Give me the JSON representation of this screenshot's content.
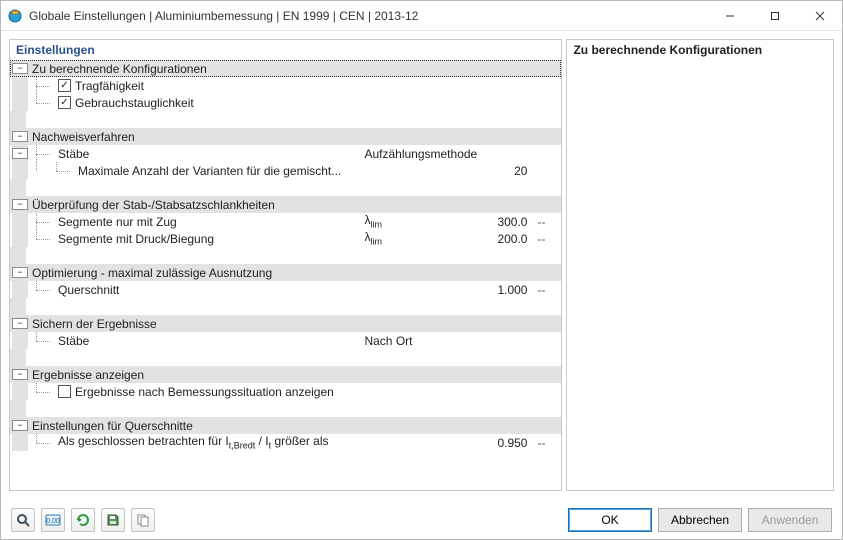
{
  "window": {
    "title": "Globale Einstellungen | Aluminiumbemessung | EN 1999 | CEN | 2013-12"
  },
  "left_panel_header": "Einstellungen",
  "right_panel_header": "Zu berechnende Konfigurationen",
  "sections": {
    "configs": {
      "title": "Zu berechnende Konfigurationen",
      "items": {
        "tragf": "Tragfähigkeit",
        "gebr": "Gebrauchstauglichkeit"
      }
    },
    "verfahren": {
      "title": "Nachweisverfahren",
      "staebe": "Stäbe",
      "staebe_col2": "Aufzählungsmethode",
      "max_var": "Maximale Anzahl der Varianten für die gemischt...",
      "max_var_val": "20"
    },
    "schlank": {
      "title": "Überprüfung der Stab-/Stabsatzschlankheiten",
      "seg_zug": "Segmente nur mit Zug",
      "seg_zug_val": "300.0",
      "seg_druck": "Segmente mit Druck/Biegung",
      "seg_druck_val": "200.0",
      "lambda": "λ",
      "lambda_sub": "lim"
    },
    "opt": {
      "title": "Optimierung - maximal zulässige Ausnutzung",
      "quer": "Querschnitt",
      "quer_val": "1.000"
    },
    "sichern": {
      "title": "Sichern der Ergebnisse",
      "staebe": "Stäbe",
      "staebe_val": "Nach Ort"
    },
    "anzeigen": {
      "title": "Ergebnisse anzeigen",
      "cb": "Ergebnisse nach Bemessungssituation anzeigen"
    },
    "querschn": {
      "title": "Einstellungen für Querschnitte",
      "row_prefix": "Als geschlossen betrachten für I",
      "row_sub1": "t,Bredt",
      "row_mid": " / I",
      "row_sub2": "t",
      "row_suffix": " größer als",
      "val": "0.950"
    }
  },
  "dash": "--",
  "buttons": {
    "ok": "OK",
    "cancel": "Abbrechen",
    "apply": "Anwenden"
  },
  "checkmark": "✓",
  "minus": "−"
}
